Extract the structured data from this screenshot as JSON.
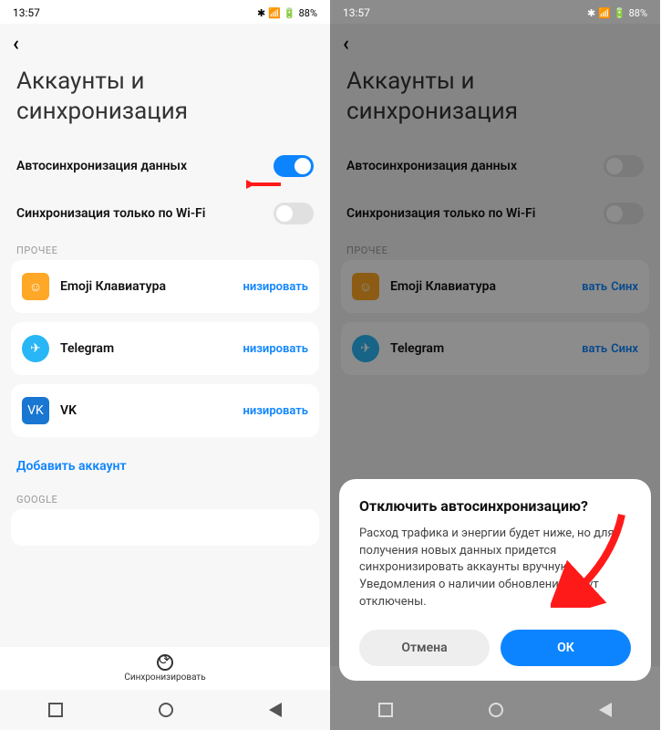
{
  "status": {
    "time": "13:57",
    "battery": "88%"
  },
  "page_title": "Аккаунты и\nсинхронизация",
  "settings": {
    "autosync_label": "Автосинхронизация данных",
    "wifi_only_label": "Синхронизация только по Wi-Fi"
  },
  "sections": {
    "other": "ПРОЧЕЕ",
    "google": "GOOGLE"
  },
  "accounts": [
    {
      "name": "Emoji Клавиатура",
      "action": "низировать"
    },
    {
      "name": "Telegram",
      "action": "низировать"
    },
    {
      "name": "VK",
      "action": "низировать"
    }
  ],
  "add_account": "Добавить аккаунт",
  "sync_button": "Синхронизировать",
  "dialog": {
    "title": "Отключить автосинхронизацию?",
    "text": "Расход трафика и энергии будет ниже, но для получения новых данных придется синхронизировать аккаунты вручную. Уведомления о наличии обновлений будут отключены.",
    "cancel": "Отмена",
    "ok": "ОК"
  },
  "right_actions": {
    "a1": "вать",
    "a2": "Синх"
  }
}
